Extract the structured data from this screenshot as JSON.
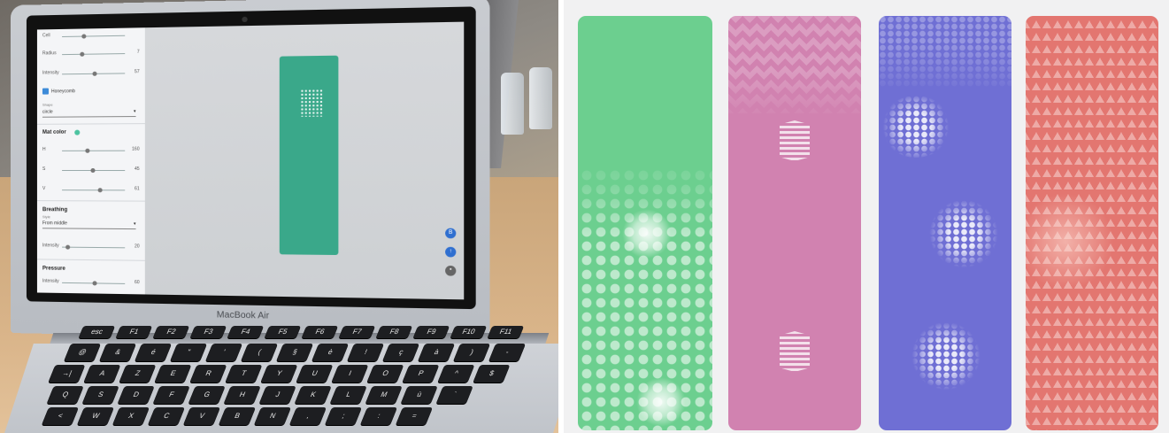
{
  "photo": {
    "laptop_brand": "MacBook Air",
    "settings_panel": {
      "sliders_top": [
        {
          "label": "Cell",
          "value": ""
        },
        {
          "label": "Radius",
          "value": "7"
        },
        {
          "label": "Intensity",
          "value": "57"
        }
      ],
      "honeycomb_label": "Honeycomb",
      "shape_label": "Shape",
      "shape_value": "circle",
      "mat_color_heading": "Mat color",
      "color_sliders": [
        {
          "label": "H",
          "value": "160"
        },
        {
          "label": "S",
          "value": "45"
        },
        {
          "label": "V",
          "value": "61"
        }
      ],
      "breathing_heading": "Breathing",
      "breathing_style_label": "Style",
      "breathing_style_value": "From middle",
      "breathing_intensity": {
        "label": "Intensity",
        "value": "20"
      },
      "pressure_heading": "Pressure",
      "pressure_intensity": {
        "label": "Intensity",
        "value": "60"
      }
    },
    "keyboard_rows": [
      [
        "esc",
        "F1",
        "F2",
        "F3",
        "F4",
        "F5",
        "F6",
        "F7",
        "F8",
        "F9",
        "F10",
        "F11"
      ],
      [
        "@",
        "&",
        "é",
        "\"",
        "'",
        "(",
        "§",
        "è",
        "!",
        "ç",
        "à",
        ")",
        "-"
      ],
      [
        "→|",
        "A",
        "Z",
        "E",
        "R",
        "T",
        "Y",
        "U",
        "I",
        "O",
        "P",
        "^",
        "$"
      ],
      [
        "Q",
        "S",
        "D",
        "F",
        "G",
        "H",
        "J",
        "K",
        "L",
        "M",
        "ù",
        "`"
      ],
      [
        "<",
        "W",
        "X",
        "C",
        "V",
        "B",
        "N",
        ",",
        ";",
        ":",
        "="
      ]
    ]
  },
  "mats": {
    "colors": {
      "green": "#6ccf8f",
      "pink": "#d182b0",
      "blue": "#6f6fd4",
      "red": "#e37670"
    },
    "patterns": [
      "circle-dots",
      "chevrons",
      "honeycomb",
      "triangles"
    ]
  }
}
